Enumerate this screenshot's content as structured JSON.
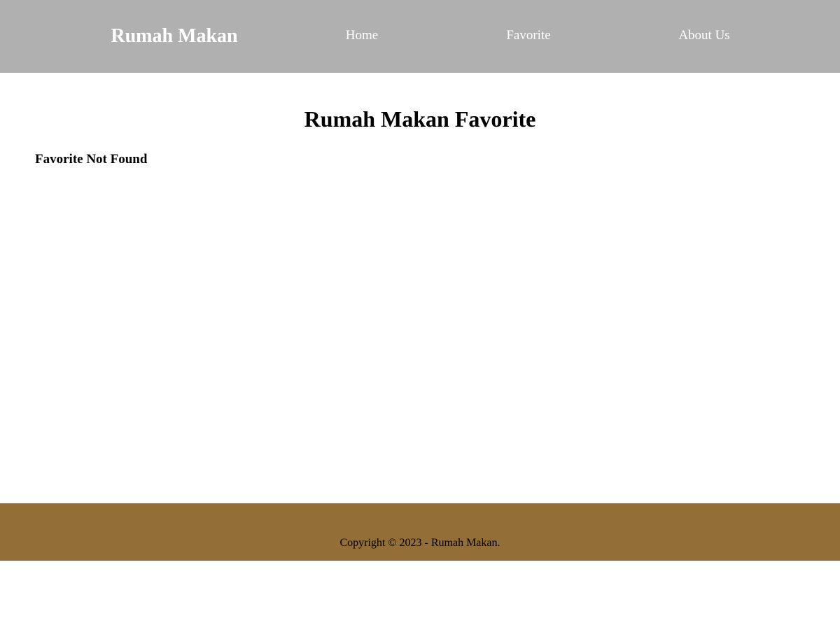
{
  "header": {
    "brand": "Rumah Makan",
    "nav": {
      "home": "Home",
      "favorite": "Favorite",
      "about": "About Us"
    },
    "background_color": "#b0b0b0",
    "text_color": "#ffffff"
  },
  "main": {
    "title": "Rumah Makan Favorite",
    "empty_message": "Favorite Not Found"
  },
  "footer": {
    "copyright": "Copyright © 2023 - Rumah Makan.",
    "background_color": "#936e36"
  }
}
